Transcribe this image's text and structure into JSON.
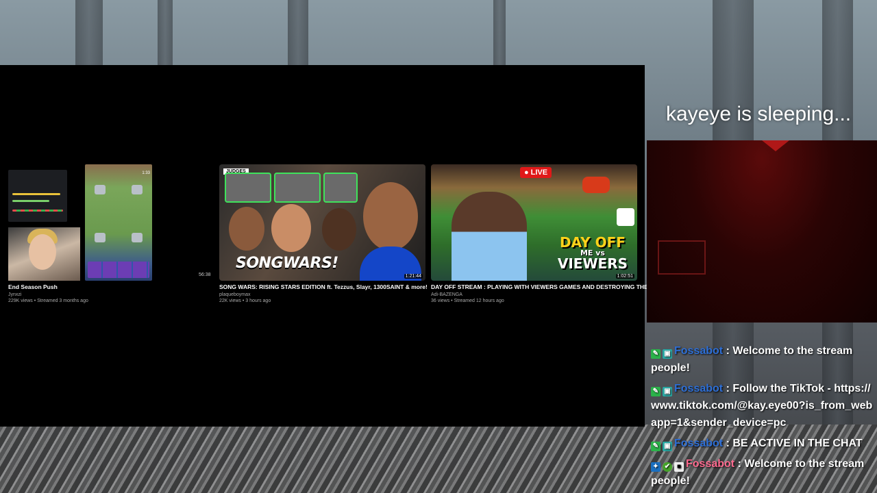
{
  "overlay": {
    "status_text": "kayeye is sleeping..."
  },
  "videos": [
    {
      "title": "End Season Push",
      "channel": "Jynxzi",
      "views": "229K views",
      "streamed": "Streamed 3 months ago",
      "duration": "1:33"
    },
    {
      "title": "SONG WARS: RISING STARS EDITION ft. Tezzus, Slayr, 1300SAINT & more!",
      "channel": "plaqueboymax",
      "views": "22K views",
      "streamed": "3 hours ago",
      "duration": "1:21:44",
      "thumb_tag": "JUDGES",
      "thumb_text": "SONGWARS!"
    },
    {
      "title": "DAY OFF STREAM : PLAYING WITH VIEWERS GAMES AND DESTROYING THEM",
      "channel": "Adi-BAZENGA",
      "views": "36 views",
      "streamed": "Streamed 12 hours ago",
      "duration": "1:02:51",
      "live_badge": "LIVE",
      "thumb_line1": "DAY OFF",
      "thumb_line2": "ME vs",
      "thumb_line3": "VIEWERS"
    }
  ],
  "side_duration": "56:38",
  "chat": {
    "messages": [
      {
        "user": "Fossabot",
        "badges": [
          "mod-icon",
          "bot-icon"
        ],
        "user_color": "#2e6fd6",
        "text": "Welcome to the stream people!"
      },
      {
        "user": "Fossabot",
        "badges": [
          "mod-icon",
          "bot-icon"
        ],
        "user_color": "#2e6fd6",
        "text": "Follow the TikTok - https://www.tiktok.com/@kay.eye00?is_from_webapp=1&sender_device=pc"
      },
      {
        "user": "Fossabot",
        "badges": [
          "mod-icon",
          "bot-icon"
        ],
        "user_color": "#2e6fd6",
        "text": "BE ACTIVE IN THE CHAT"
      },
      {
        "user": "Fossabot",
        "badges": [
          "vip-icon",
          "verified-icon",
          "box-icon"
        ],
        "user_color": "#ff6a8f",
        "text": "Welcome to the stream people!"
      }
    ],
    "separator": " : "
  }
}
